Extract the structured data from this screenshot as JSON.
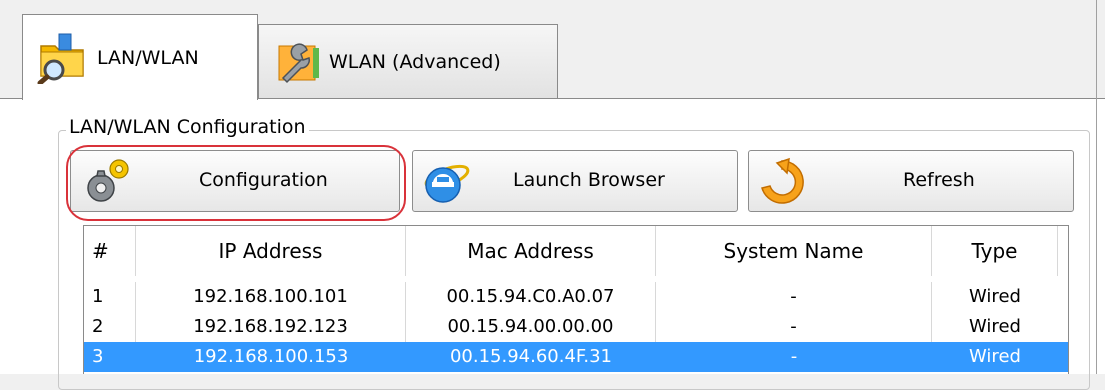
{
  "tabs": [
    {
      "label": "LAN/WLAN",
      "icon": "folder-search-icon",
      "active": true
    },
    {
      "label": "WLAN (Advanced)",
      "icon": "wrench-icon",
      "active": false
    }
  ],
  "group": {
    "title": "LAN/WLAN Configuration"
  },
  "toolbar": {
    "configuration_label": "Configuration",
    "launch_browser_label": "Launch Browser",
    "refresh_label": "Refresh"
  },
  "table": {
    "columns": [
      "#",
      "IP Address",
      "Mac Address",
      "System Name",
      "Type"
    ],
    "rows": [
      {
        "num": "1",
        "ip": "192.168.100.101",
        "mac": "00.15.94.C0.A0.07",
        "name": "-",
        "type": "Wired"
      },
      {
        "num": "2",
        "ip": "192.168.192.123",
        "mac": "00.15.94.00.00.00",
        "name": "-",
        "type": "Wired"
      },
      {
        "num": "3",
        "ip": "192.168.100.153",
        "mac": "00.15.94.60.4F.31",
        "name": "-",
        "type": "Wired"
      }
    ],
    "selected_row": 2
  },
  "colors": {
    "selection": "#3399ff",
    "highlight": "#d9323a"
  }
}
